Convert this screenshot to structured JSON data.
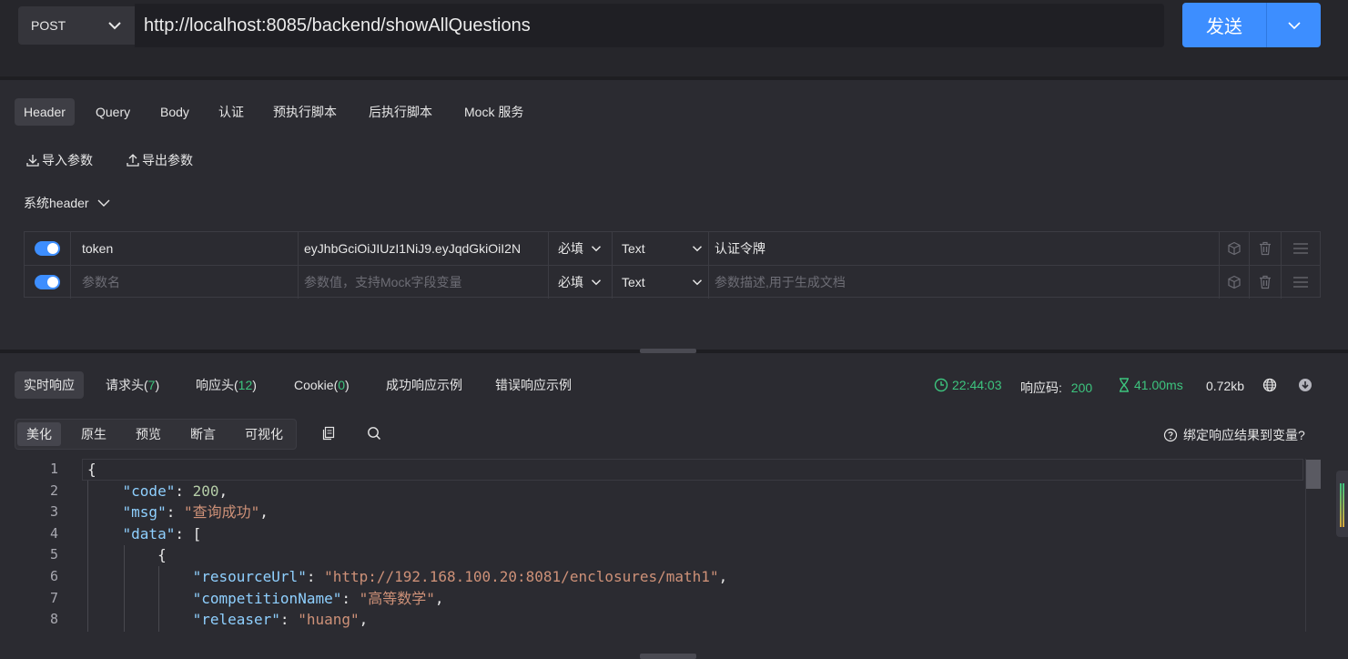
{
  "request": {
    "method": "POST",
    "url": "http://localhost:8085/backend/showAllQuestions",
    "send_label": "发送"
  },
  "request_tabs": [
    "Header",
    "Query",
    "Body",
    "认证",
    "预执行脚本",
    "后执行脚本",
    "Mock 服务"
  ],
  "tools": {
    "import_label": "导入参数",
    "export_label": "导出参数",
    "system_header_label": "系统header"
  },
  "params": [
    {
      "enabled": true,
      "name": "token",
      "value": "eyJhbGciOiJIUzI1NiJ9.eyJqdGkiOiI2N",
      "required": "必填",
      "type": "Text",
      "description": "认证令牌"
    }
  ],
  "param_placeholders": {
    "name": "参数名",
    "value": "参数值，支持Mock字段变量",
    "required": "必填",
    "type": "Text",
    "description": "参数描述,用于生成文档"
  },
  "response": {
    "tabs": [
      {
        "label": "实时响应"
      },
      {
        "label": "请求头(",
        "count": "7",
        "suffix": ")"
      },
      {
        "label": "响应头(",
        "count": "12",
        "suffix": ")"
      },
      {
        "label": "Cookie(",
        "count": "0",
        "suffix": ")"
      },
      {
        "label": "成功响应示例"
      },
      {
        "label": "错误响应示例"
      }
    ],
    "time": "22:44:03",
    "status_label": "响应码:",
    "status_code": "200",
    "duration": "41.00ms",
    "size": "0.72kb",
    "view_tabs": [
      "美化",
      "原生",
      "预览",
      "断言",
      "可视化"
    ],
    "bind_link": "绑定响应结果到变量?",
    "code_lines": [
      {
        "num": "1",
        "tokens": [
          [
            "p",
            "{"
          ]
        ]
      },
      {
        "num": "2",
        "tokens": [
          [
            "p",
            "    "
          ],
          [
            "k",
            "\"code\""
          ],
          [
            "p",
            ": "
          ],
          [
            "n",
            "200"
          ],
          [
            "p",
            ","
          ]
        ]
      },
      {
        "num": "3",
        "tokens": [
          [
            "p",
            "    "
          ],
          [
            "k",
            "\"msg\""
          ],
          [
            "p",
            ": "
          ],
          [
            "s",
            "\"查询成功\""
          ],
          [
            "p",
            ","
          ]
        ]
      },
      {
        "num": "4",
        "tokens": [
          [
            "p",
            "    "
          ],
          [
            "k",
            "\"data\""
          ],
          [
            "p",
            ": ["
          ]
        ]
      },
      {
        "num": "5",
        "tokens": [
          [
            "p",
            "        {"
          ]
        ]
      },
      {
        "num": "6",
        "tokens": [
          [
            "p",
            "            "
          ],
          [
            "k",
            "\"resourceUrl\""
          ],
          [
            "p",
            ": "
          ],
          [
            "s",
            "\"http://192.168.100.20:8081/enclosures/math1\""
          ],
          [
            "p",
            ","
          ]
        ]
      },
      {
        "num": "7",
        "tokens": [
          [
            "p",
            "            "
          ],
          [
            "k",
            "\"competitionName\""
          ],
          [
            "p",
            ": "
          ],
          [
            "s",
            "\"高等数学\""
          ],
          [
            "p",
            ","
          ]
        ]
      },
      {
        "num": "8",
        "tokens": [
          [
            "p",
            "            "
          ],
          [
            "k",
            "\"releaser\""
          ],
          [
            "p",
            ": "
          ],
          [
            "s",
            "\"huang\""
          ],
          [
            "p",
            ","
          ]
        ]
      }
    ]
  },
  "colors": {
    "accent": "#3d8eff",
    "success": "#3dc47e",
    "background": "#2b2b31"
  }
}
